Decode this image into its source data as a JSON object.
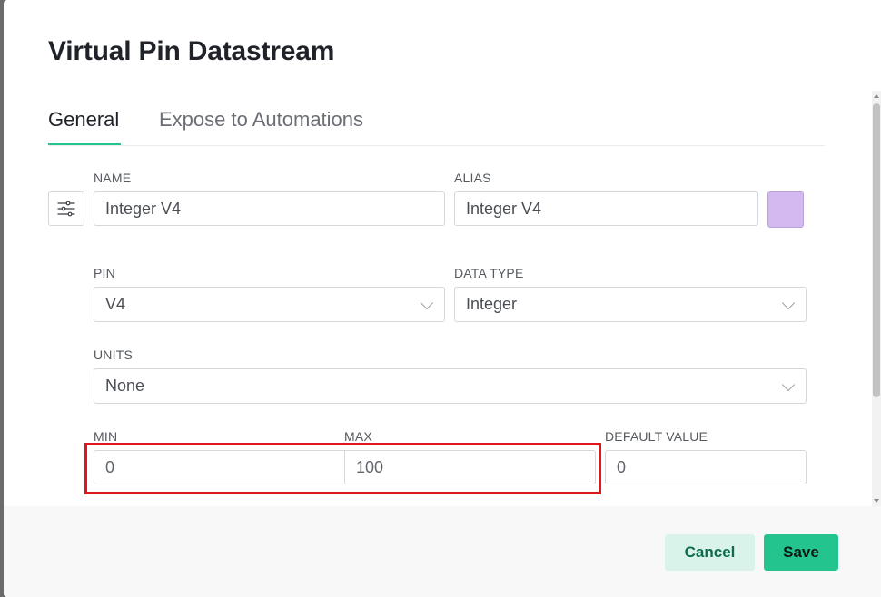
{
  "modal": {
    "title": "Virtual Pin Datastream"
  },
  "tabs": [
    {
      "label": "General",
      "active": true
    },
    {
      "label": "Expose to Automations",
      "active": false
    }
  ],
  "form": {
    "name": {
      "label": "NAME",
      "value": "Integer V4"
    },
    "alias": {
      "label": "ALIAS",
      "value": "Integer V4"
    },
    "color": "#d4b9f0",
    "pin": {
      "label": "PIN",
      "value": "V4"
    },
    "data_type": {
      "label": "DATA TYPE",
      "value": "Integer"
    },
    "units": {
      "label": "UNITS",
      "value": "None"
    },
    "min": {
      "label": "MIN",
      "value": "0"
    },
    "max": {
      "label": "MAX",
      "value": "100"
    },
    "default_value": {
      "label": "DEFAULT VALUE",
      "value": "0"
    }
  },
  "footer": {
    "cancel_label": "Cancel",
    "save_label": "Save"
  },
  "colors": {
    "accent": "#23c48e",
    "highlight": "#e0161e"
  }
}
